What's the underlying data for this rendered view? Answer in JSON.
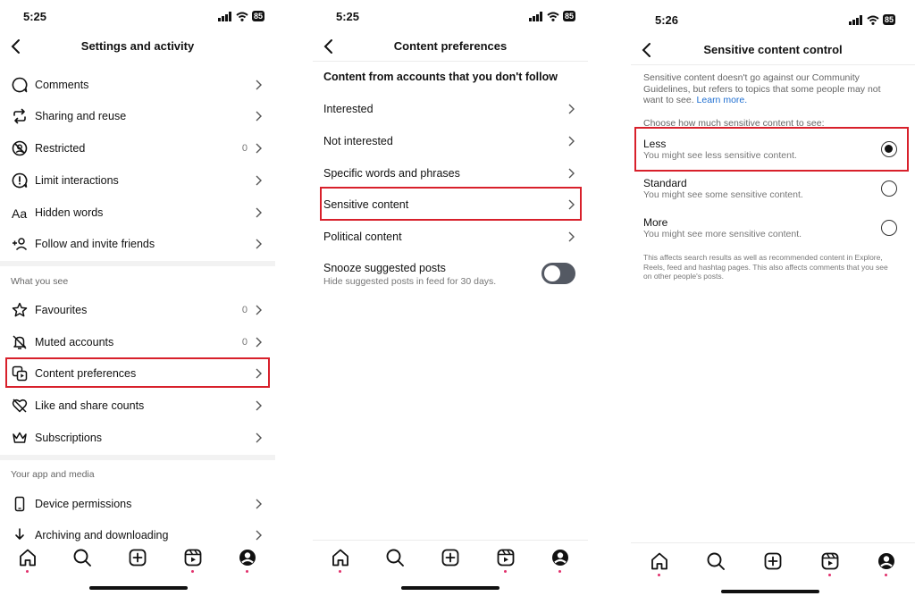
{
  "colors": {
    "highlight": "#d8202b",
    "link": "#1f6fd1",
    "toggle_off": "#545963",
    "notification_dot": "#e1306c"
  },
  "screens": [
    {
      "status": {
        "time": "5:25",
        "battery": "85"
      },
      "title": "Settings and activity",
      "items": [
        {
          "label": "Comments",
          "icon": "comment-icon"
        },
        {
          "label": "Sharing and reuse",
          "icon": "repost-icon"
        },
        {
          "label": "Restricted",
          "icon": "restricted-icon",
          "count": "0"
        },
        {
          "label": "Limit interactions",
          "icon": "alert-circle-icon"
        },
        {
          "label": "Hidden words",
          "icon": "text-aa-icon"
        },
        {
          "label": "Follow and invite friends",
          "icon": "add-person-icon"
        }
      ],
      "section_see": "What you see",
      "items_see": [
        {
          "label": "Favourites",
          "icon": "star-icon",
          "count": "0"
        },
        {
          "label": "Muted accounts",
          "icon": "muted-bell-icon",
          "count": "0"
        },
        {
          "label": "Content preferences",
          "icon": "media-stack-icon"
        },
        {
          "label": "Like and share counts",
          "icon": "heart-off-icon"
        },
        {
          "label": "Subscriptions",
          "icon": "crown-icon"
        }
      ],
      "section_app": "Your app and media",
      "items_app": [
        {
          "label": "Device permissions",
          "icon": "phone-icon"
        },
        {
          "label": "Archiving and downloading",
          "icon": "download-icon"
        }
      ]
    },
    {
      "status": {
        "time": "5:25",
        "battery": "85"
      },
      "title": "Content preferences",
      "subheading": "Content from accounts that you don't follow",
      "items": [
        {
          "label": "Interested"
        },
        {
          "label": "Not interested"
        },
        {
          "label": "Specific words and phrases"
        },
        {
          "label": "Sensitive content"
        },
        {
          "label": "Political content"
        }
      ],
      "snooze": {
        "title": "Snooze suggested posts",
        "description": "Hide suggested posts in feed for 30 days.",
        "enabled": false
      }
    },
    {
      "status": {
        "time": "5:26",
        "battery": "85"
      },
      "title": "Sensitive content control",
      "description": "Sensitive content doesn't go against our Community Guidelines, but refers to topics that some people may not want to see.",
      "learn_more": "Learn more.",
      "choose_label": "Choose how much sensitive content to see:",
      "options": [
        {
          "title": "Less",
          "description": "You might see less sensitive content.",
          "selected": true
        },
        {
          "title": "Standard",
          "description": "You might see some sensitive content.",
          "selected": false
        },
        {
          "title": "More",
          "description": "You might see more sensitive content.",
          "selected": false
        }
      ],
      "footnote": "This affects search results as well as recommended content in Explore, Reels, feed and hashtag pages. This also affects comments that you see on other people's posts."
    }
  ],
  "tab_icons": [
    "home-icon",
    "search-icon",
    "create-icon",
    "reels-icon",
    "profile-icon"
  ]
}
